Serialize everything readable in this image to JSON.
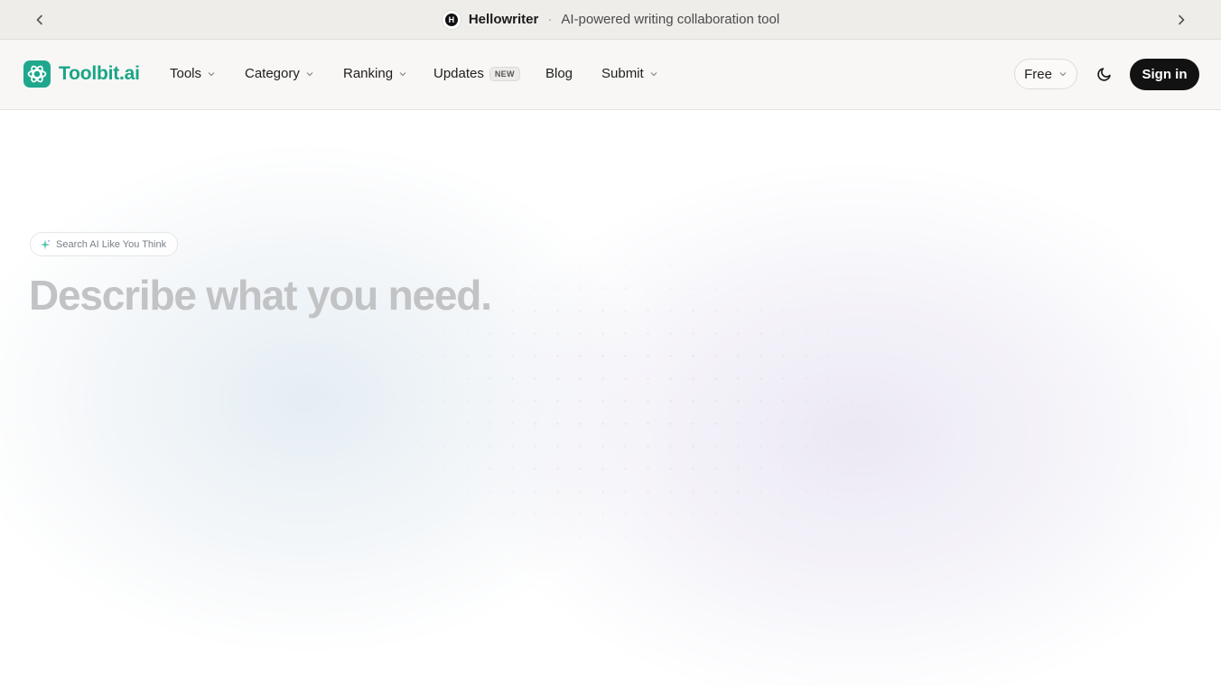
{
  "announcement": {
    "name": "Hellowriter",
    "separator": "·",
    "description": "AI-powered writing collaboration tool",
    "logo_letter": "H"
  },
  "brand": {
    "name": "Toolbit.ai",
    "color": "#1aa587"
  },
  "nav": {
    "tools": "Tools",
    "category": "Category",
    "ranking": "Ranking",
    "updates": "Updates",
    "updates_badge": "NEW",
    "blog": "Blog",
    "submit": "Submit"
  },
  "actions": {
    "pricing_filter": "Free",
    "sign_in": "Sign in",
    "theme_icon": "moon-icon"
  },
  "hero": {
    "pill_label": "Search AI Like You Think",
    "headline": "Describe what you need."
  }
}
